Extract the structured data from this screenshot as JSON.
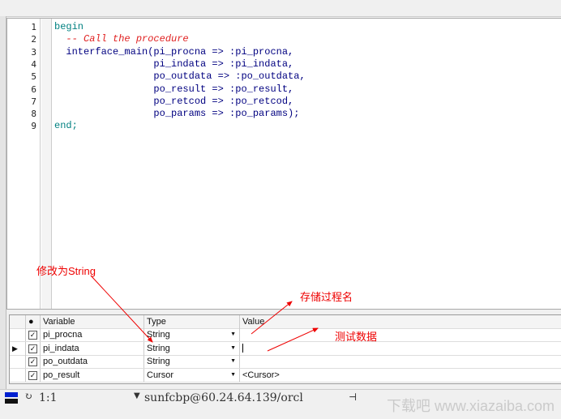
{
  "editor": {
    "line_numbers": [
      "1",
      "2",
      "3",
      "4",
      "5",
      "6",
      "7",
      "8",
      "9"
    ],
    "lines": [
      {
        "text": "begin",
        "cls": "kw"
      },
      {
        "text": "  -- Call the procedure",
        "cls": "cmt"
      },
      {
        "text": "  interface_main(pi_procna => :pi_procna,",
        "cls": ""
      },
      {
        "text": "                 pi_indata => :pi_indata,",
        "cls": ""
      },
      {
        "text": "                 po_outdata => :po_outdata,",
        "cls": ""
      },
      {
        "text": "                 po_result => :po_result,",
        "cls": ""
      },
      {
        "text": "                 po_retcod => :po_retcod,",
        "cls": ""
      },
      {
        "text": "                 po_params => :po_params);",
        "cls": ""
      },
      {
        "text": "end;",
        "cls": "kw"
      }
    ]
  },
  "grid": {
    "headers": {
      "variable": "Variable",
      "type": "Type",
      "value": "Value"
    },
    "rows": [
      {
        "variable": "pi_procna",
        "type": "String",
        "value": "",
        "checked": true
      },
      {
        "variable": "pi_indata",
        "type": "String",
        "value": "",
        "checked": true,
        "current": true
      },
      {
        "variable": "po_outdata",
        "type": "String",
        "value": "",
        "checked": true
      },
      {
        "variable": "po_result",
        "type": "Cursor",
        "value": "<Cursor>",
        "checked": true
      }
    ]
  },
  "status": {
    "position": "1:1",
    "connection": "sunfcbp@60.24.64.139/orcl"
  },
  "annotations": {
    "change_to_string": "修改为String",
    "procedure_name": "存储过程名",
    "test_data": "测试数据"
  },
  "watermark": "下载吧 www.xiazaiba.com"
}
